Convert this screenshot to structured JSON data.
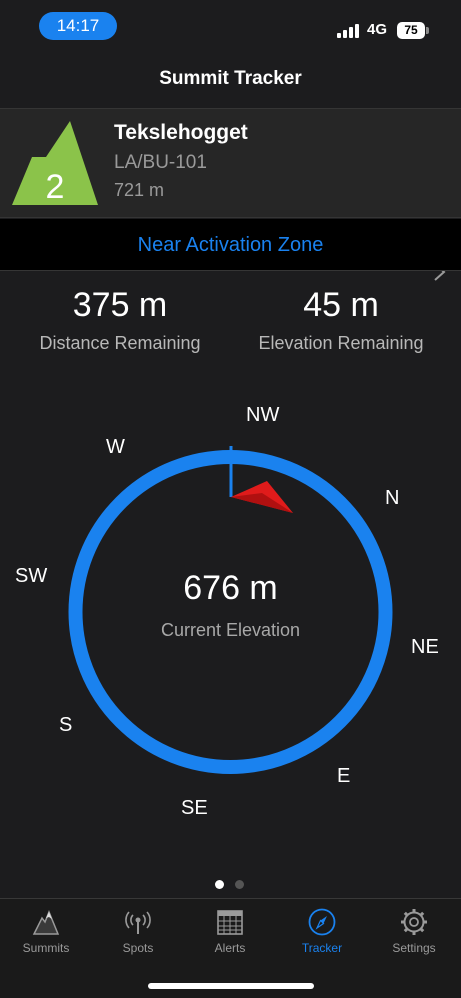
{
  "status_bar": {
    "time": "14:17",
    "network": "4G",
    "battery": "75"
  },
  "nav": {
    "title": "Summit Tracker"
  },
  "summit": {
    "points": "2",
    "name": "Tekslehogget",
    "reference": "LA/BU-101",
    "altitude": "721 m",
    "icon_color": "#8bc34a"
  },
  "zone_banner": {
    "text": "Near Activation Zone"
  },
  "stats": {
    "distance_value": "375 m",
    "distance_label": "Distance Remaining",
    "elevation_value": "45 m",
    "elevation_label": "Elevation Remaining"
  },
  "compass": {
    "directions": {
      "nw": "NW",
      "n": "N",
      "ne": "NE",
      "e": "E",
      "se": "SE",
      "s": "S",
      "sw": "SW",
      "w": "W"
    },
    "current_elevation_value": "676 m",
    "current_elevation_label": "Current Elevation",
    "ring_color": "#1a82ef",
    "pointer_color": "#e01b1b"
  },
  "pager": {
    "pages": 2,
    "active": 1
  },
  "tabs": [
    {
      "label": "Summits",
      "icon": "mountain-icon"
    },
    {
      "label": "Spots",
      "icon": "antenna-icon"
    },
    {
      "label": "Alerts",
      "icon": "calendar-icon"
    },
    {
      "label": "Tracker",
      "icon": "compass-icon",
      "active": true
    },
    {
      "label": "Settings",
      "icon": "gear-icon"
    }
  ],
  "colors": {
    "accent": "#1a82ef",
    "background": "#1c1c1e"
  }
}
